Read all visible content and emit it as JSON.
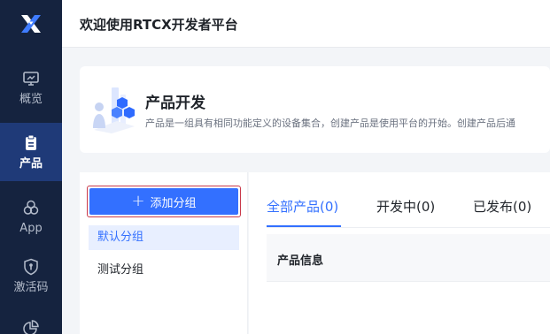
{
  "header": {
    "title": "欢迎使用RTCX开发者平台"
  },
  "sidebar": {
    "items": [
      {
        "label": "概览",
        "icon": "monitor-icon",
        "active": false
      },
      {
        "label": "产品",
        "icon": "clipboard-icon",
        "active": true
      },
      {
        "label": "App",
        "icon": "app-circles-icon",
        "active": false
      },
      {
        "label": "激活码",
        "icon": "shield-key-icon",
        "active": false
      }
    ]
  },
  "intro": {
    "title": "产品开发",
    "description": "产品是一组具有相同功能定义的设备集合，创建产品是使用平台的开始。创建产品后通"
  },
  "groups": {
    "add_label": "添加分组",
    "items": [
      {
        "label": "默认分组",
        "selected": true
      },
      {
        "label": "测试分组",
        "selected": false
      }
    ]
  },
  "tabs": [
    {
      "label": "全部产品(0)",
      "active": true
    },
    {
      "label": "开发中(0)",
      "active": false
    },
    {
      "label": "已发布(0)",
      "active": false
    }
  ],
  "table": {
    "columns": [
      "产品信息"
    ]
  },
  "colors": {
    "primary": "#3370ff",
    "sidebar": "#15233f",
    "sidebar_active": "#1f3a78"
  }
}
